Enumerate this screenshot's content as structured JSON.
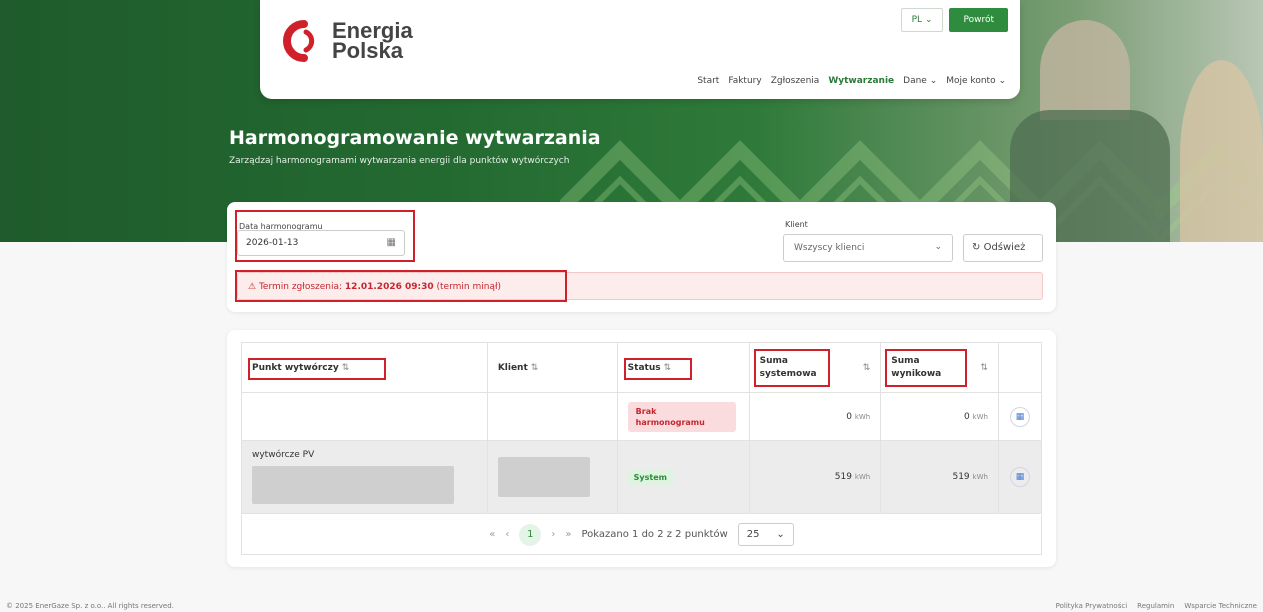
{
  "brand": {
    "line1": "Energia",
    "line2": "Polska",
    "primary_color": "#2f8c3e",
    "logo_color": "#d0202a"
  },
  "header": {
    "lang": "PL",
    "back_label": "Powrót",
    "menu": [
      {
        "label": "Start"
      },
      {
        "label": "Faktury"
      },
      {
        "label": "Zgłoszenia"
      },
      {
        "label": "Wytwarzanie",
        "active": true
      },
      {
        "label": "Dane"
      },
      {
        "label": "Moje konto"
      }
    ]
  },
  "page": {
    "title": "Harmonogramowanie wytwarzania",
    "subtitle": "Zarządzaj harmonogramami wytwarzania energii dla punktów wytwórczych"
  },
  "filters": {
    "date_label": "Data harmonogramu",
    "date_value": "2026-01-13",
    "client_label": "Klient",
    "client_value": "Wszyscy klienci",
    "refresh_label": "Odśwież"
  },
  "alert": {
    "prefix": "Termin zgłoszenia:",
    "datetime": "12.01.2026 09:30",
    "suffix": "(termin minął)"
  },
  "table": {
    "columns": [
      "Punkt wytwórczy",
      "Klient",
      "Status",
      "Suma systemowa",
      "Suma wynikowa"
    ],
    "rows": [
      {
        "point": "",
        "client": "",
        "status": "Brak harmonogramu",
        "sys": "0",
        "res": "0",
        "unit": "kWh"
      },
      {
        "point": "wytwórcze PV",
        "client": "",
        "status": "System",
        "sys": "519",
        "res": "519",
        "unit": "kWh"
      }
    ]
  },
  "pagination": {
    "first": "«",
    "prev": "‹",
    "current": "1",
    "next": "›",
    "last": "»",
    "info": "Pokazano 1 do 2 z 2 punktów",
    "per_page": "25"
  },
  "footer": {
    "copyright": "© 2025 EnerGaze Sp. z o.o.. All rights reserved.",
    "links": [
      "Polityka Prywatności",
      "Regulamin",
      "Wsparcie Techniczne"
    ]
  }
}
